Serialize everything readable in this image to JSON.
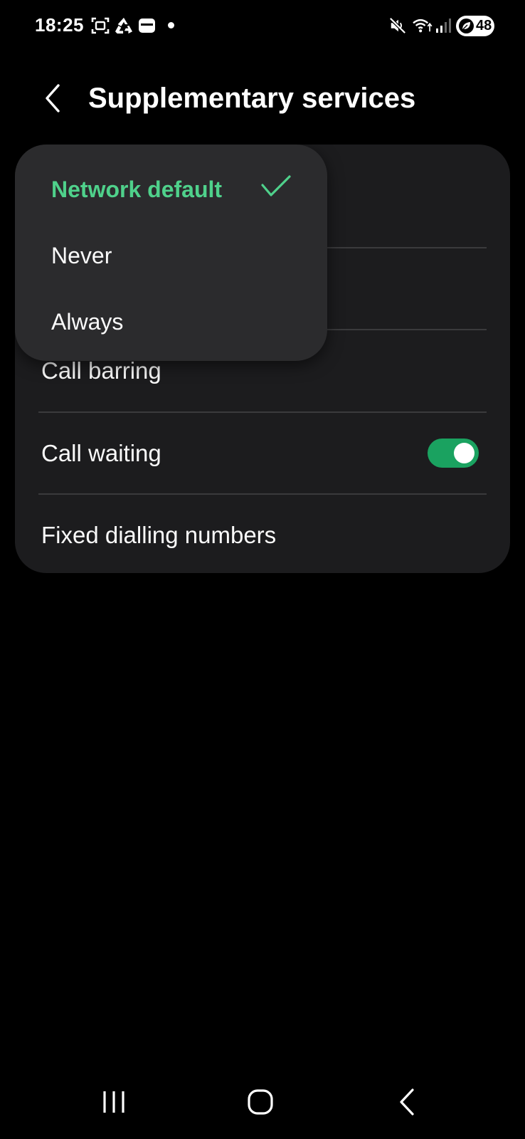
{
  "status_bar": {
    "time": "18:25",
    "left_icons": [
      "screenshot-icon",
      "recycle-icon",
      "wallet-icon",
      "notification-dot"
    ],
    "right_icons": [
      "mute-icon",
      "wifi-icon",
      "signal-icon"
    ],
    "battery_level": "48"
  },
  "header": {
    "back_icon": "chevron-left-icon",
    "title": "Supplementary services"
  },
  "settings": {
    "items": [
      {
        "label": "Call barring"
      },
      {
        "label": "Call waiting",
        "toggle_on": true
      },
      {
        "label": "Fixed dialling numbers"
      }
    ]
  },
  "dropdown": {
    "options": [
      {
        "label": "Network default",
        "selected": true
      },
      {
        "label": "Never",
        "selected": false
      },
      {
        "label": "Always",
        "selected": false
      }
    ]
  },
  "colors": {
    "accent": "#4fd18b",
    "toggle_on": "#1aa260",
    "card_bg": "#1c1c1e",
    "popup_bg": "#2b2b2d"
  },
  "navbar": {
    "buttons": [
      "recents-icon",
      "home-icon",
      "back-icon"
    ]
  }
}
